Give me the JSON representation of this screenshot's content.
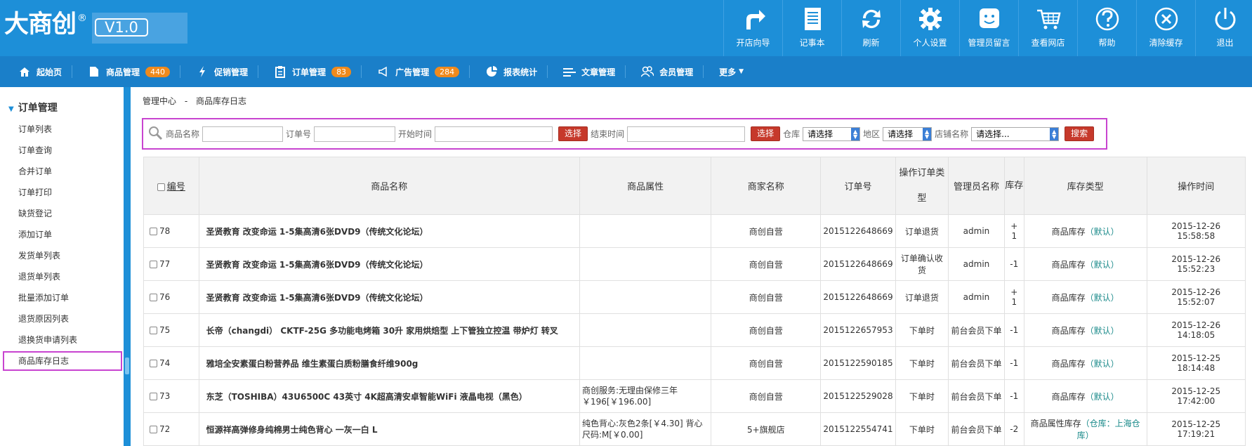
{
  "brand": {
    "name": "大商创",
    "reg": "®",
    "version": "V1.0"
  },
  "topnav": [
    {
      "label": "开店向导",
      "icon": "share-arrow-icon"
    },
    {
      "label": "记事本",
      "icon": "notepad-icon"
    },
    {
      "label": "刷新",
      "icon": "refresh-icon"
    },
    {
      "label": "个人设置",
      "icon": "gear-icon"
    },
    {
      "label": "管理员留言",
      "icon": "message-icon"
    },
    {
      "label": "查看网店",
      "icon": "cart-icon"
    },
    {
      "label": "帮助",
      "icon": "help-icon"
    },
    {
      "label": "清除缓存",
      "icon": "close-circle-icon"
    },
    {
      "label": "退出",
      "icon": "power-icon"
    }
  ],
  "menubar": [
    {
      "label": "起始页",
      "icon": "home-icon",
      "badge": ""
    },
    {
      "label": "商品管理",
      "icon": "folder-icon",
      "badge": "440"
    },
    {
      "label": "促销管理",
      "icon": "lightning-icon",
      "badge": ""
    },
    {
      "label": "订单管理",
      "icon": "clipboard-icon",
      "badge": "83"
    },
    {
      "label": "广告管理",
      "icon": "megaphone-icon",
      "badge": "284"
    },
    {
      "label": "报表统计",
      "icon": "pie-chart-icon",
      "badge": ""
    },
    {
      "label": "文章管理",
      "icon": "list-icon",
      "badge": ""
    },
    {
      "label": "会员管理",
      "icon": "users-icon",
      "badge": ""
    },
    {
      "label": "更多",
      "icon": "caret-down-icon",
      "badge": ""
    }
  ],
  "sidebar": {
    "title": "订单管理",
    "items": [
      "订单列表",
      "订单查询",
      "合并订单",
      "订单打印",
      "缺货登记",
      "添加订单",
      "发货单列表",
      "退货单列表",
      "批量添加订单",
      "退货原因列表",
      "退换货申请列表",
      "商品库存日志"
    ],
    "active": "商品库存日志"
  },
  "breadcrumb": {
    "root": "管理中心",
    "sep": "-",
    "current": "商品库存日志"
  },
  "search": {
    "goods_name_label": "商品名称",
    "order_no_label": "订单号",
    "start_time_label": "开始时间",
    "select_btn": "选择",
    "end_time_label": "结束时间",
    "warehouse_label": "仓库",
    "warehouse_value": "请选择",
    "region_label": "地区",
    "region_value": "请选择",
    "shop_label": "店铺名称",
    "shop_value": "请选择...",
    "search_btn": "搜索"
  },
  "table": {
    "headers": {
      "id": "编号",
      "name": "商品名称",
      "attr": "商品属性",
      "shop": "商家名称",
      "order": "订单号",
      "op_type": "操作订单类型",
      "admin": "管理员名称",
      "stock": "库存",
      "stock_type": "库存类型",
      "time": "操作时间"
    },
    "rows": [
      {
        "id": "78",
        "name": "圣贤教育 改变命运 1-5集高清6张DVD9（传统文化论坛）",
        "attr": "",
        "shop": "商创自营",
        "order": "2015122648669",
        "op": "订单退货",
        "admin": "admin",
        "stock": "+ 1",
        "stype": "商品库存",
        "wh": "（默认）",
        "date": "2015-12-26",
        "time": "15:58:58"
      },
      {
        "id": "77",
        "name": "圣贤教育 改变命运 1-5集高清6张DVD9（传统文化论坛）",
        "attr": "",
        "shop": "商创自营",
        "order": "2015122648669",
        "op": "订单确认收货",
        "admin": "admin",
        "stock": "-1",
        "stype": "商品库存",
        "wh": "（默认）",
        "date": "2015-12-26",
        "time": "15:52:23"
      },
      {
        "id": "76",
        "name": "圣贤教育 改变命运 1-5集高清6张DVD9（传统文化论坛）",
        "attr": "",
        "shop": "商创自营",
        "order": "2015122648669",
        "op": "订单退货",
        "admin": "admin",
        "stock": "+ 1",
        "stype": "商品库存",
        "wh": "（默认）",
        "date": "2015-12-26",
        "time": "15:52:07"
      },
      {
        "id": "75",
        "name": "长帝（changdi） CKTF-25G 多功能电烤箱 30升 家用烘焙型 上下管独立控温 带炉灯 转叉",
        "attr": "",
        "shop": "商创自营",
        "order": "2015122657953",
        "op": "下单时",
        "admin": "前台会员下单",
        "stock": "-1",
        "stype": "商品库存",
        "wh": "（默认）",
        "date": "2015-12-26",
        "time": "14:18:05"
      },
      {
        "id": "74",
        "name": "雅培全安素蛋白粉营养品 维生素蛋白质粉膳食纤维900g",
        "attr": "",
        "shop": "商创自营",
        "order": "2015122590185",
        "op": "下单时",
        "admin": "前台会员下单",
        "stock": "-1",
        "stype": "商品库存",
        "wh": "（默认）",
        "date": "2015-12-25",
        "time": "18:14:48"
      },
      {
        "id": "73",
        "name": "东芝（TOSHIBA）43U6500C 43英寸 4K超高清安卓智能WiFi 液晶电视（黑色）",
        "attr": "商创服务:无理由保修三年 ￥196[￥196.00]",
        "shop": "商创自营",
        "order": "2015122529028",
        "op": "下单时",
        "admin": "前台会员下单",
        "stock": "-1",
        "stype": "商品库存",
        "wh": "（默认）",
        "date": "2015-12-25",
        "time": "17:42:00"
      },
      {
        "id": "72",
        "name": "恒源祥高弹修身纯棉男士纯色背心 一灰一白 L",
        "attr": "纯色背心:灰色2条[￥4.30] 背心尺码:M[￥0.00]",
        "shop": "5+旗舰店",
        "order": "2015122554741",
        "op": "下单时",
        "admin": "前台会员下单",
        "stock": "-2",
        "stype": "商品属性库存",
        "wh": "（仓库：上海仓库）",
        "date": "2015-12-25",
        "time": "17:19:21"
      }
    ]
  },
  "colors": {
    "header": "#1d8fd8",
    "menubar": "#1a7fc9",
    "badge": "#f08a1c",
    "btn": "#c6392b",
    "highlight": "#c844d0"
  }
}
